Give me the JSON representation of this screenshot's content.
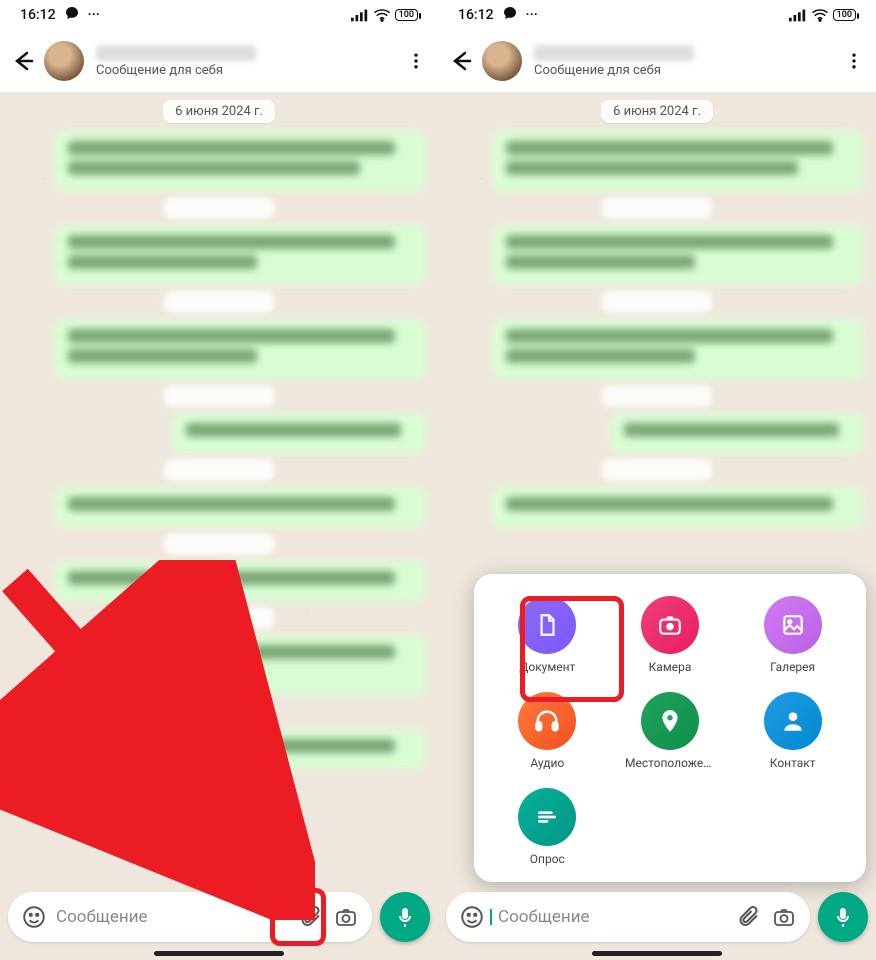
{
  "status": {
    "time": "16:12",
    "battery": "100"
  },
  "chat": {
    "subtitle": "Сообщение для себя",
    "date": "6 июня 2024 г."
  },
  "input": {
    "placeholder": "Сообщение"
  },
  "attach": {
    "document": "Документ",
    "camera": "Камера",
    "gallery": "Галерея",
    "audio": "Аудио",
    "location": "Местоположен…",
    "contact": "Контакт",
    "poll": "Опрос"
  }
}
